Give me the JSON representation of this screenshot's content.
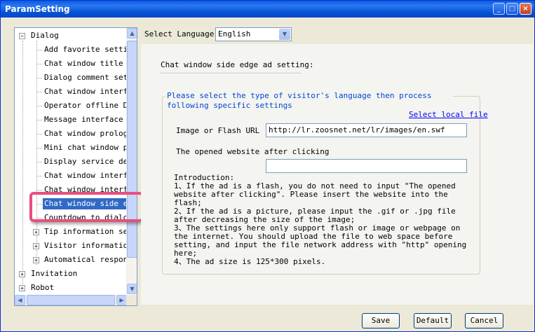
{
  "window": {
    "title": "ParamSetting"
  },
  "tree": {
    "nodes": [
      {
        "label": "Dialog",
        "expander": "−"
      },
      {
        "label": "Add favorite setting"
      },
      {
        "label": "Chat window title se"
      },
      {
        "label": "Dialog comment setti"
      },
      {
        "label": "Chat window interfac"
      },
      {
        "label": "Operator offline Dis"
      },
      {
        "label": "Message interface se"
      },
      {
        "label": "Chat window prologue"
      },
      {
        "label": "Mini chat window pro"
      },
      {
        "label": "Display service depa"
      },
      {
        "label": "Chat window interfac"
      },
      {
        "label": "Chat window interfac"
      },
      {
        "label": "Chat window side edg"
      },
      {
        "label": "Countdown to dialog"
      },
      {
        "label": "Tip information sett",
        "expander": "+"
      },
      {
        "label": "Visitor information",
        "expander": "+"
      },
      {
        "label": "Automatical response",
        "expander": "+"
      },
      {
        "label": "Invitation",
        "expander": "+"
      },
      {
        "label": "Robot",
        "expander": "+"
      }
    ],
    "selected_index": 12
  },
  "language": {
    "label": "Select Language",
    "value": "English"
  },
  "section": {
    "label": "Chat window side edge ad setting:"
  },
  "group": {
    "title": "Please select the type of visitor's language then process following specific settings",
    "select_local_file": "Select local file",
    "image_url_label": "Image or Flash URL",
    "image_url_value": "http://lr.zoosnet.net/lr/images/en.swf",
    "website_label": "The opened website after clicking",
    "website_value": "",
    "introduction": "Introduction:\n1、If the ad is a flash, you do not need to input \"The opened website after clicking\". Please insert the website into the flash;\n2、If the ad is a picture, please input the .gif or .jpg file after decreasing the size of the image;\n3、The settings here only support flash or image or webpage on the internet. You should upload the file to web space before setting, and input the file network address with \"http\" opening here;\n4、The ad size is 125*300 pixels."
  },
  "buttons": {
    "save": "Save",
    "default": "Default",
    "cancel": "Cancel"
  },
  "colors": {
    "selected": "#316ac5",
    "highlight": "#e94f7c",
    "group_title": "#0046d5"
  }
}
